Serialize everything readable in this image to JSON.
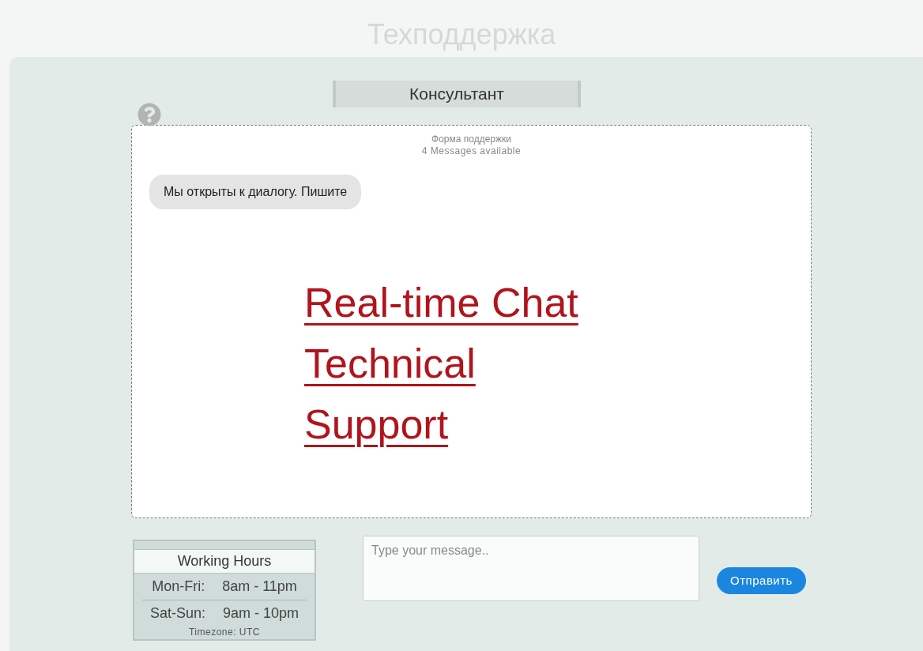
{
  "page_title": "Техподдержка",
  "chat": {
    "header": "Консультант",
    "form_title": "Форма поддержки",
    "messages_available": "4 Messages available",
    "messages": [
      {
        "text": "Мы открыты к диалогу. Пишите"
      }
    ],
    "caption": [
      "Real-time Chat",
      "Technical",
      "Support"
    ]
  },
  "working_hours": {
    "title": "Working Hours",
    "rows": [
      {
        "days": "Mon-Fri:",
        "hours": "8am - 11pm"
      },
      {
        "days": "Sat-Sun:",
        "hours": "9am - 10pm"
      }
    ],
    "timezone": "Timezone: UTC"
  },
  "message_field": {
    "placeholder": "Type your message.."
  },
  "send_button": "Отправить"
}
